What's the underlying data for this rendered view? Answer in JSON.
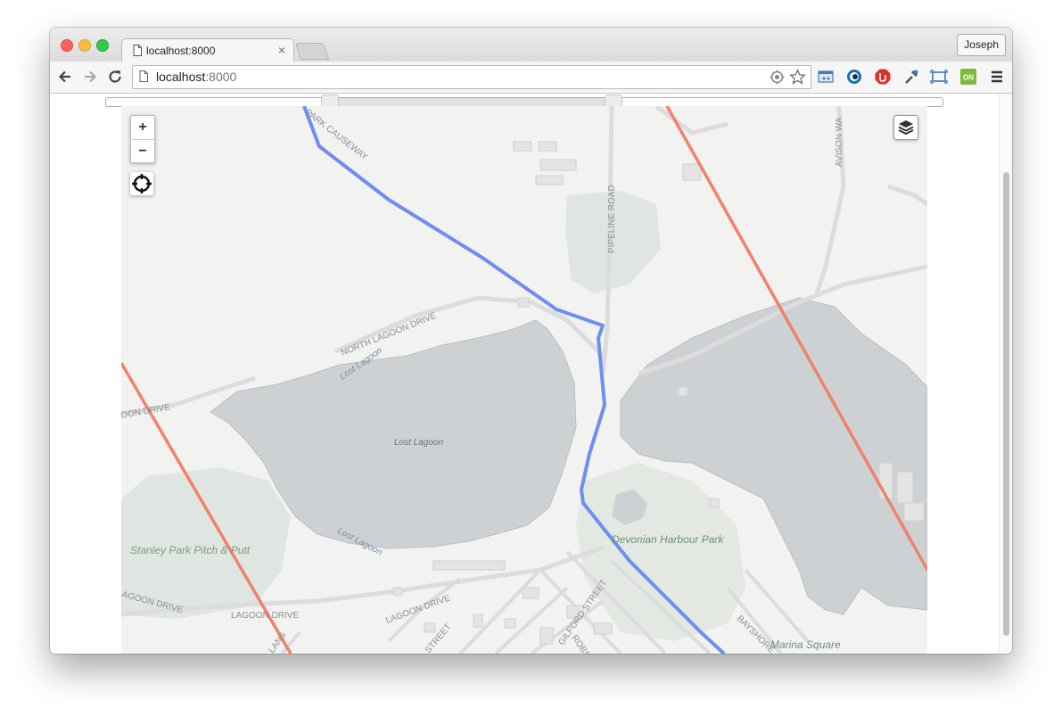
{
  "browser": {
    "tab_title": "localhost:8000",
    "tab_close": "×",
    "profile_name": "Joseph",
    "address_host": "localhost",
    "address_port": ":8000"
  },
  "map": {
    "zoom_in": "+",
    "zoom_out": "−",
    "labels": {
      "pipeline_road": "PIPELINE ROAD",
      "north_lagoon_drive": "NORTH LAGOON DRIVE",
      "lost_lagoon_upper": "Lost Lagoon",
      "lost_lagoon_center": "Lost Lagoon",
      "lost_lagoon_lower": "Lost Lagoon",
      "lagoon_drive_left": "OON DRIVE",
      "stanley_park_pitch_putt": "Stanley Park Pitch & Putt",
      "devonian_harbour_park": "Devonian Harbour Park",
      "marina_square": "Marina Square",
      "lagoon_drive_1": "AGOON DRIVE",
      "lagoon_drive_2": "LAGOON DRIVE",
      "lagoon_drive_3": "LAGOON DRIVE",
      "gilford_street": "GILFORD STREET",
      "robson": "ROBS",
      "street_partial": "STREET",
      "bayshore": "BAYSHORE",
      "avison_way": "AVISON WA",
      "causeway": "PARK CAUSEWAY",
      "lans": "LANS"
    }
  },
  "colors": {
    "route": "#6e8ef0",
    "red_line": "#f0826a",
    "water": "#cdd1d3",
    "park": "#dfe5e0",
    "land": "#f2f2f1"
  }
}
